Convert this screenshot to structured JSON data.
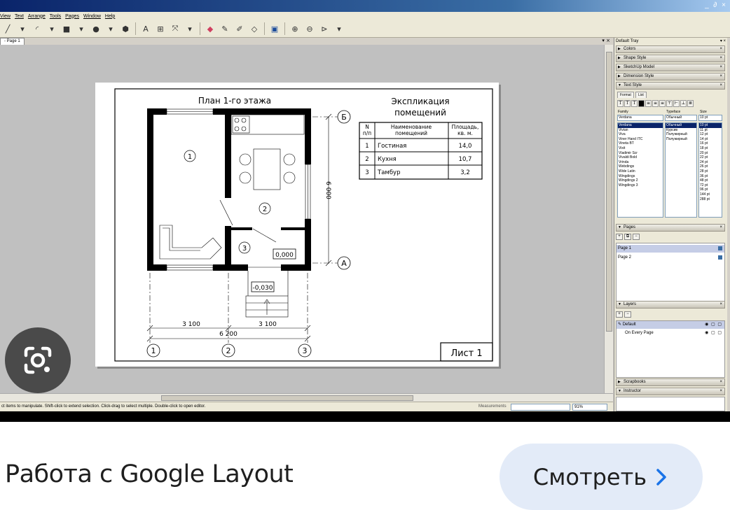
{
  "window": {
    "controls": "_ ∂ ×"
  },
  "menu": [
    "View",
    "Text",
    "Arrange",
    "Tools",
    "Pages",
    "Window",
    "Help"
  ],
  "tabs": {
    "active": "Page 1"
  },
  "drawing": {
    "plan_title": "План 1-го этажа",
    "expl_title_1": "Экспликация",
    "expl_title_2": "помещений",
    "table": {
      "headers": [
        [
          "N",
          "п/п"
        ],
        [
          "Наименование",
          "помещений"
        ],
        [
          "Площадь,",
          "кв. м."
        ]
      ],
      "rows": [
        [
          "1",
          "Гостиная",
          "14,0"
        ],
        [
          "2",
          "Кухня",
          "10,7"
        ],
        [
          "3",
          "Тамбур",
          "3,2"
        ]
      ]
    },
    "rooms": [
      "1",
      "2",
      "3"
    ],
    "axis_letters": [
      "Б",
      "А"
    ],
    "axis_numbers": [
      "1",
      "2",
      "3"
    ],
    "levels": [
      "0,000",
      "-0,030"
    ],
    "dims": {
      "left": "3 100",
      "right": "3 100",
      "total": "6 200",
      "height": "6 000"
    },
    "sheet": "Лист 1"
  },
  "status": {
    "hint": "ct items to manipulate. Shift-click to extend selection. Click-drag to select multiple. Double-click to open editor.",
    "measure_label": "Measurements",
    "zoom": "91%"
  },
  "tray": {
    "title": "Default Tray",
    "panels": [
      "Colors",
      "Shape Style",
      "SketchUp Model",
      "Dimension Style",
      "Text Style"
    ],
    "text_style": {
      "subtabs": [
        "Format",
        "List"
      ],
      "family_label": "Family",
      "typeface_label": "Typeface",
      "size_label": "Size",
      "family_value": "Verdana",
      "typeface_value": "Обычный",
      "size_value": "10 pt",
      "families": [
        "Verdana",
        "Vivian",
        "Viva",
        "Viner Hand ITC",
        "Vineta BT",
        "Vixit",
        "Vladimir Scr",
        "Vivaldi Bold",
        "Vrinda",
        "Webdings",
        "Wide Latin",
        "Wingdings",
        "Wingdings 2",
        "Wingdings 3"
      ],
      "typefaces": [
        "Обычный",
        "Курсив",
        "Полужирный",
        "Полужирный"
      ],
      "sizes": [
        "10 pt",
        "11 pt",
        "12 pt",
        "14 pt",
        "16 pt",
        "18 pt",
        "20 pt",
        "22 pt",
        "24 pt",
        "26 pt",
        "28 pt",
        "36 pt",
        "48 pt",
        "72 pt",
        "96 pt",
        "144 pt",
        "288 pt"
      ]
    },
    "pages_title": "Pages",
    "pages": [
      "Page 1",
      "Page 2"
    ],
    "layers_title": "Layers",
    "layers": [
      "Default",
      "On Every Page"
    ],
    "scrapbooks_title": "Scrapbooks",
    "instructor_title": "Instructor"
  },
  "caption": "Работа с Google Layout",
  "watch_label": "Смотреть",
  "colors": {
    "accent": "#1a73e8",
    "pill": "#e3ebf8"
  }
}
